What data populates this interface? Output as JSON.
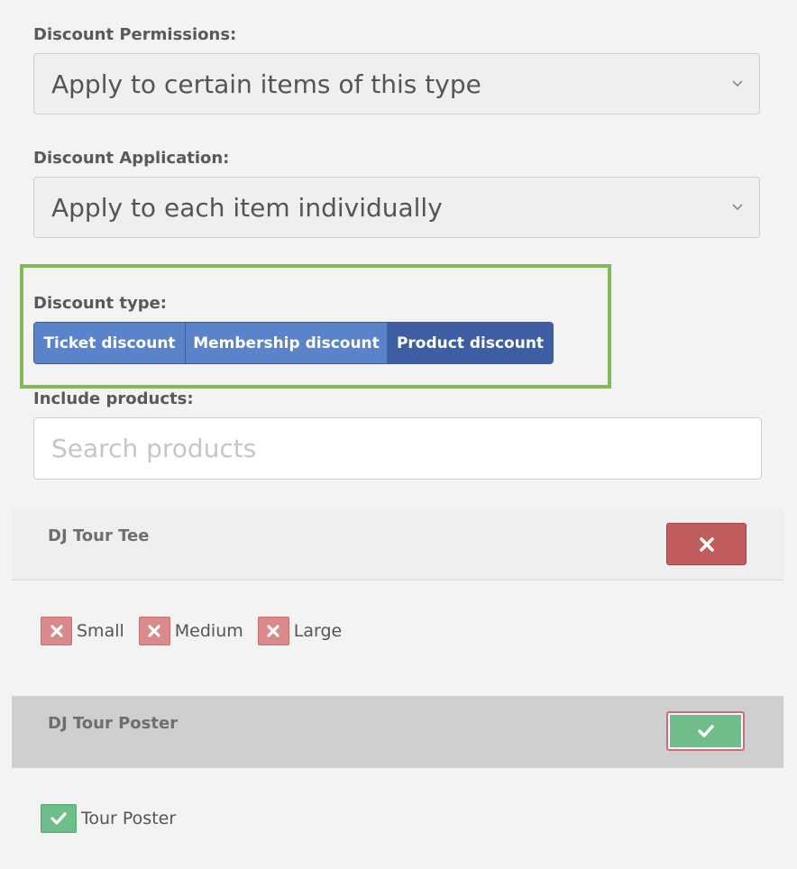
{
  "permissions": {
    "label": "Discount Permissions:",
    "value": "Apply to certain items of this type"
  },
  "application": {
    "label": "Discount Application:",
    "value": "Apply to each item individually"
  },
  "discount_type": {
    "label": "Discount type:",
    "options": [
      "Ticket discount",
      "Membership discount",
      "Product discount"
    ],
    "selected": "Product discount"
  },
  "include_products": {
    "label": "Include products:",
    "placeholder": "Search products"
  },
  "products": [
    {
      "name": "DJ Tour Tee",
      "included": false,
      "variants": [
        {
          "label": "Small",
          "checked": false
        },
        {
          "label": "Medium",
          "checked": false
        },
        {
          "label": "Large",
          "checked": false
        }
      ]
    },
    {
      "name": "DJ Tour Poster",
      "included": true,
      "variants": [
        {
          "label": "Tour Poster",
          "checked": true
        }
      ]
    }
  ],
  "colors": {
    "highlight": "#84b95a",
    "button": "#5a83c9",
    "button_active": "#3e5ea3",
    "remove": "#c25d5d",
    "add": "#6fbd8b"
  }
}
